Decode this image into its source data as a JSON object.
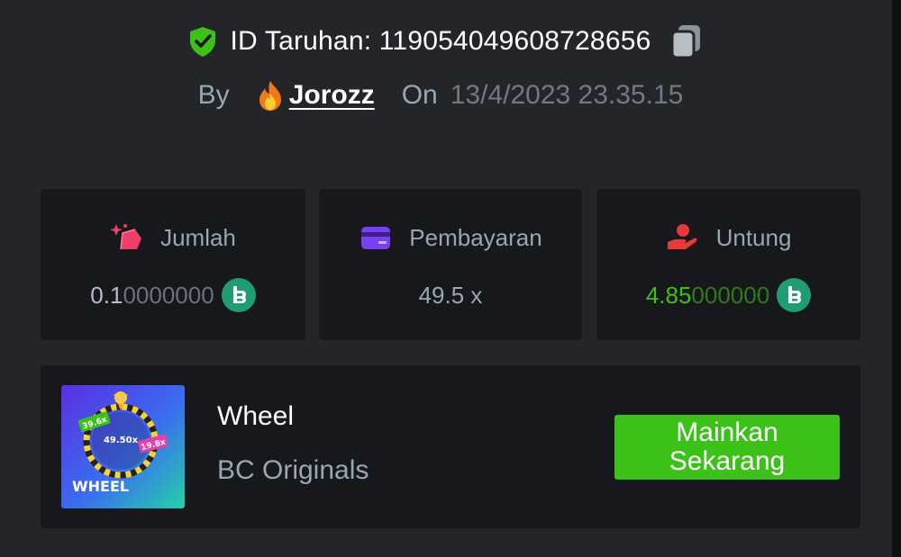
{
  "header": {
    "bet_id_label": "ID Taruhan: 119054049608728656",
    "by_label": "By",
    "username": "Jorozz",
    "on_label": "On",
    "date": "13/4/2023 23.35.15",
    "icons": [
      "shield-check-icon",
      "copy-icon",
      "fire-icon"
    ]
  },
  "stats": {
    "amount": {
      "label": "Jumlah",
      "value_main": "0.1",
      "value_dim": "0000000",
      "icon": "bet-amount-icon"
    },
    "payout": {
      "label": "Pembayaran",
      "value": "49.5 x",
      "icon": "wallet-card-icon"
    },
    "profit": {
      "label": "Untung",
      "value_main": "4.85",
      "value_dim": "000000",
      "icon": "hand-profit-icon"
    }
  },
  "game": {
    "title": "Wheel",
    "provider": "BC Originals",
    "thumbnail_text": "WHEEL",
    "thumbnail_multipliers": [
      "39.6x",
      "49.50x",
      "19.8x"
    ],
    "play_button": "Mainkan\nSekarang"
  },
  "colors": {
    "background": "#232529",
    "card": "#17181b",
    "accent_green": "#3bc117",
    "muted_text": "#98a7b5",
    "shield_green": "#3bc117",
    "amount_icon": "#f13f6c",
    "payout_icon": "#7a3ff2",
    "profit_icon": "#e83a3a",
    "coin": "#1f9c72"
  }
}
